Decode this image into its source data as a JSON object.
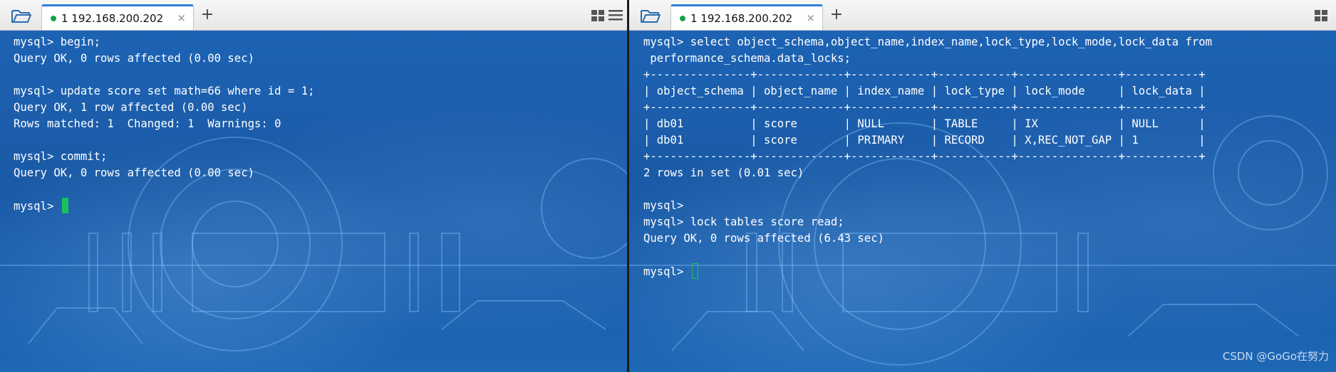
{
  "left_pane": {
    "tab": {
      "label": "1 192.168.200.202",
      "close": "×"
    },
    "add_tab": "+",
    "icons": [
      "folder-open-icon",
      "tile-grid-icon",
      "menu-lines-icon"
    ],
    "terminal_lines": [
      "mysql> begin;",
      "Query OK, 0 rows affected (0.00 sec)",
      "",
      "mysql> update score set math=66 where id = 1;",
      "Query OK, 1 row affected (0.00 sec)",
      "Rows matched: 1  Changed: 1  Warnings: 0",
      "",
      "mysql> commit;",
      "Query OK, 0 rows affected (0.00 sec)",
      "",
      "mysql> "
    ]
  },
  "right_pane": {
    "tab": {
      "label": "1 192.168.200.202",
      "close": "×"
    },
    "add_tab": "+",
    "icons": [
      "folder-open-icon",
      "tile-grid-icon"
    ],
    "terminal_lines": [
      "mysql> select object_schema,object_name,index_name,lock_type,lock_mode,lock_data from",
      " performance_schema.data_locks;",
      "+---------------+-------------+------------+-----------+---------------+-----------+",
      "| object_schema | object_name | index_name | lock_type | lock_mode     | lock_data |",
      "+---------------+-------------+------------+-----------+---------------+-----------+",
      "| db01          | score       | NULL       | TABLE     | IX            | NULL      |",
      "| db01          | score       | PRIMARY    | RECORD    | X,REC_NOT_GAP | 1         |",
      "+---------------+-------------+------------+-----------+---------------+-----------+",
      "2 rows in set (0.01 sec)",
      "",
      "mysql> ",
      "mysql> lock tables score read;",
      "Query OK, 0 rows affected (6.43 sec)",
      "",
      "mysql> "
    ]
  },
  "watermark": "CSDN @GoGo在努力",
  "colors": {
    "terminal_bg": "#1a5aa6",
    "terminal_text": "#ffffff",
    "cursor": "#19c25a",
    "tab_accent": "#2f7fd4",
    "status_dot": "#16a34a"
  }
}
